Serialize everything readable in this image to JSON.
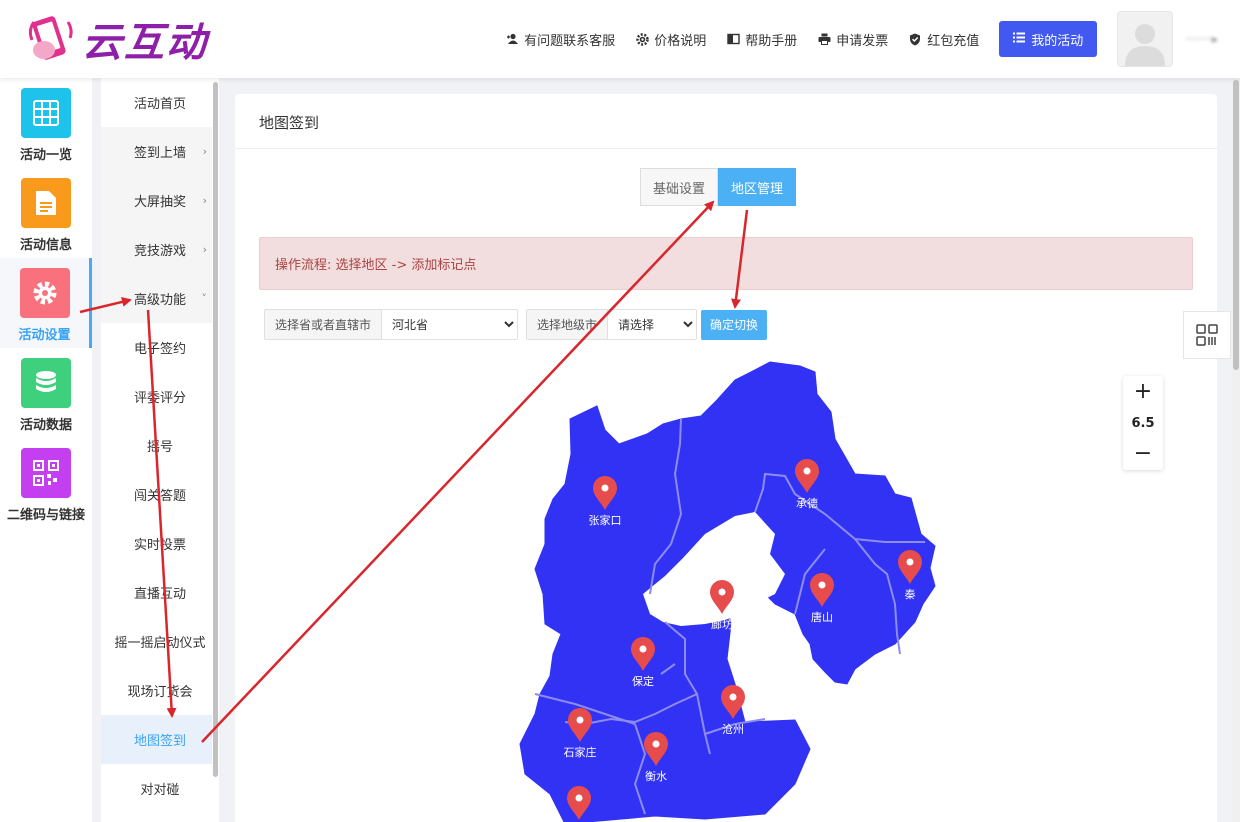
{
  "header": {
    "logo_text": "云互动",
    "nav": [
      {
        "label": "有问题联系客服",
        "icon": "add-user-icon"
      },
      {
        "label": "价格说明",
        "icon": "gear-icon"
      },
      {
        "label": "帮助手册",
        "icon": "book-icon"
      },
      {
        "label": "申请发票",
        "icon": "printer-icon"
      },
      {
        "label": "红包充值",
        "icon": "shield-check-icon"
      }
    ],
    "my_activity": "我的活动"
  },
  "iconbar": [
    {
      "label": "活动一览",
      "color": "#1ec3ec",
      "icon": "grid-icon"
    },
    {
      "label": "活动信息",
      "color": "#f99a1d",
      "icon": "document-icon"
    },
    {
      "label": "活动设置",
      "color": "#f9717c",
      "icon": "gear-icon",
      "active": true
    },
    {
      "label": "活动数据",
      "color": "#3fd07e",
      "icon": "database-icon"
    },
    {
      "label": "二维码与链接",
      "color": "#c43ff0",
      "icon": "qrcode-icon"
    }
  ],
  "submenu": [
    {
      "label": "活动首页",
      "arrow": ""
    },
    {
      "label": "签到上墙",
      "arrow": "›"
    },
    {
      "label": "大屏抽奖",
      "arrow": "›"
    },
    {
      "label": "竞技游戏",
      "arrow": "›"
    },
    {
      "label": "高级功能",
      "arrow": "˅"
    },
    {
      "label": "电子签约",
      "arrow": ""
    },
    {
      "label": "评委评分",
      "arrow": ""
    },
    {
      "label": "摇号",
      "arrow": ""
    },
    {
      "label": "闯关答题",
      "arrow": ""
    },
    {
      "label": "实时投票",
      "arrow": ""
    },
    {
      "label": "直播互动",
      "arrow": ""
    },
    {
      "label": "摇一摇启动仪式",
      "arrow": ""
    },
    {
      "label": "现场订货会",
      "arrow": ""
    },
    {
      "label": "地图签到",
      "arrow": ""
    },
    {
      "label": "对对碰",
      "arrow": ""
    }
  ],
  "main": {
    "title": "地图签到",
    "tabs": {
      "basic": "基础设置",
      "region": "地区管理"
    },
    "alert": "操作流程: 选择地区 -> 添加标记点",
    "province_label": "选择省或者直辖市",
    "province_value": "河北省",
    "city_label": "选择地级市",
    "city_value": "请选择",
    "confirm": "确定切换"
  },
  "map": {
    "fill_color": "#3232f5",
    "border_color": "#8c8cf0",
    "marker_color": "#e74c4c",
    "cities": [
      {
        "name": "张家口"
      },
      {
        "name": "承德"
      },
      {
        "name": "秦"
      },
      {
        "name": "廊坊"
      },
      {
        "name": "唐山"
      },
      {
        "name": "保定"
      },
      {
        "name": "沧州"
      },
      {
        "name": "石家庄"
      },
      {
        "name": "衡水"
      },
      {
        "name": ""
      }
    ],
    "zoom_level": "6.5",
    "zoom_in": "+",
    "zoom_out": "−"
  },
  "annotation_color": "#d9262c"
}
